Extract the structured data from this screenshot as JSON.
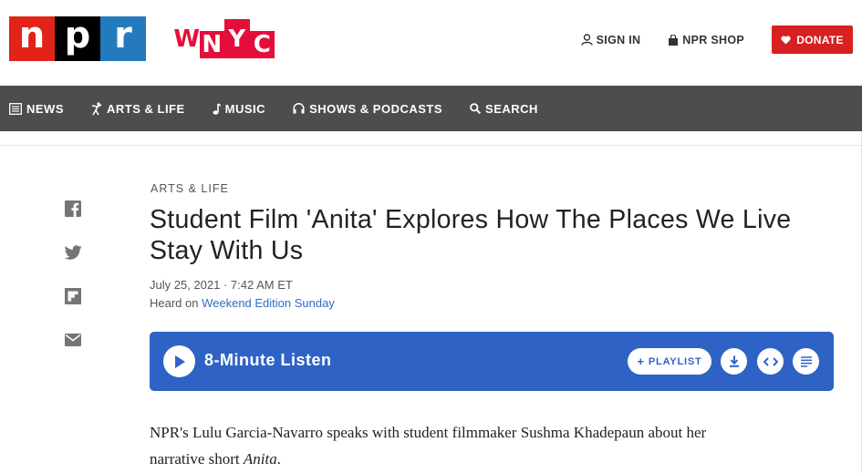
{
  "header": {
    "npr_logo": [
      "n",
      "p",
      "r"
    ],
    "wnyc_logo": [
      "W",
      "N",
      "Y",
      "C"
    ],
    "sign_in": "SIGN IN",
    "shop": "NPR SHOP",
    "donate": "DONATE"
  },
  "nav": {
    "items": [
      {
        "label": "NEWS",
        "icon": "news-icon"
      },
      {
        "label": "ARTS & LIFE",
        "icon": "arts-icon"
      },
      {
        "label": "MUSIC",
        "icon": "music-note-icon"
      },
      {
        "label": "SHOWS & PODCASTS",
        "icon": "headphones-icon"
      },
      {
        "label": "SEARCH",
        "icon": "search-icon"
      }
    ]
  },
  "share": [
    "facebook-icon",
    "twitter-icon",
    "flipboard-icon",
    "email-icon"
  ],
  "article": {
    "slug": "ARTS & LIFE",
    "title": "Student Film 'Anita' Explores How The Places We Live Stay With Us",
    "dateline": "July 25, 2021 · 7:42 AM ET",
    "heard_prefix": "Heard on ",
    "heard_show": "Weekend Edition Sunday",
    "teaser_main": "NPR's Lulu Garcia-Navarro speaks with student filmmaker Sushma Khadepaun about her narrative short ",
    "teaser_title": "Anita",
    "teaser_end": "."
  },
  "player": {
    "listen_label": "8-Minute Listen",
    "playlist_label": "PLAYLIST",
    "plus": "+"
  },
  "colors": {
    "npr_red": "#e2231a",
    "npr_black": "#000000",
    "npr_blue": "#237bbd",
    "wnyc_red": "#e50e3a",
    "nav_bg": "#4d4d4d",
    "donate_bg": "#d62021",
    "player_bg": "#2e63c5",
    "link": "#2e6dc7"
  }
}
